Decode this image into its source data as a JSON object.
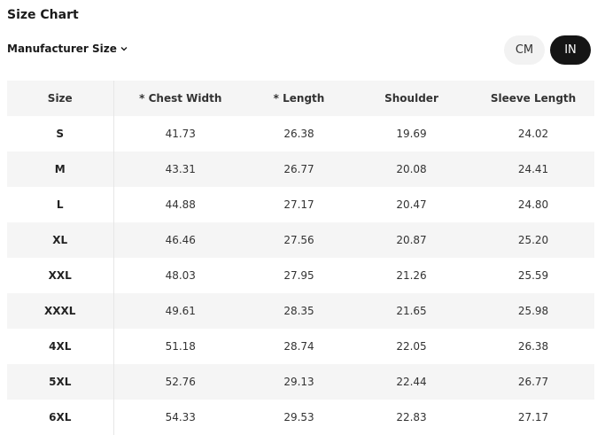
{
  "title": "Size Chart",
  "size_selector": {
    "label": "Manufacturer Size"
  },
  "unit_toggle": {
    "cm_label": "CM",
    "in_label": "IN",
    "selected": "IN"
  },
  "table": {
    "headers": [
      "Size",
      "* Chest Width",
      "* Length",
      "Shoulder",
      "Sleeve Length"
    ],
    "rows": [
      [
        "S",
        "41.73",
        "26.38",
        "19.69",
        "24.02"
      ],
      [
        "M",
        "43.31",
        "26.77",
        "20.08",
        "24.41"
      ],
      [
        "L",
        "44.88",
        "27.17",
        "20.47",
        "24.80"
      ],
      [
        "XL",
        "46.46",
        "27.56",
        "20.87",
        "25.20"
      ],
      [
        "XXL",
        "48.03",
        "27.95",
        "21.26",
        "25.59"
      ],
      [
        "XXXL",
        "49.61",
        "28.35",
        "21.65",
        "25.98"
      ],
      [
        "4XL",
        "51.18",
        "28.74",
        "22.05",
        "26.38"
      ],
      [
        "5XL",
        "52.76",
        "29.13",
        "22.44",
        "26.77"
      ],
      [
        "6XL",
        "54.33",
        "29.53",
        "22.83",
        "27.17"
      ]
    ]
  },
  "colors": {
    "active_pill": "#151515",
    "inactive_pill": "#f2f2f2",
    "stripe": "#f5f5f5"
  }
}
